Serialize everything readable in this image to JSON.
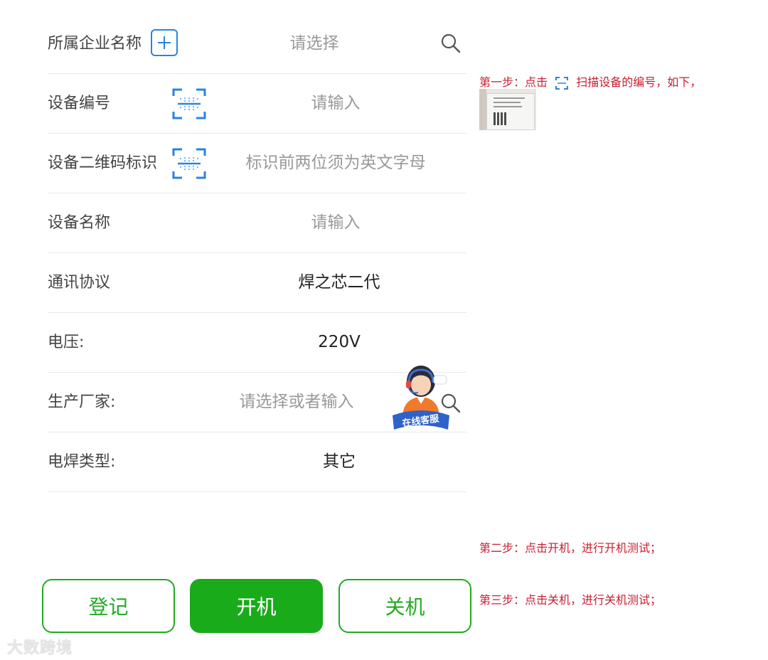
{
  "form": {
    "company": {
      "label": "所属企业名称",
      "placeholder": "请选择"
    },
    "device_no": {
      "label": "设备编号",
      "placeholder": "请输入"
    },
    "qr_id": {
      "label": "设备二维码标识",
      "placeholder": "标识前两位须为英文字母"
    },
    "device_name": {
      "label": "设备名称",
      "placeholder": "请输入"
    },
    "protocol": {
      "label": "通讯协议",
      "value": "焊之芯二代"
    },
    "voltage": {
      "label": "电压:",
      "value": "220V"
    },
    "manufacturer": {
      "label": "生产厂家:",
      "placeholder": "请选择或者输入"
    },
    "weld_type": {
      "label": "电焊类型:",
      "value": "其它"
    }
  },
  "buttons": {
    "register": "登记",
    "power_on": "开机",
    "power_off": "关机"
  },
  "notes": {
    "step1_prefix": "第一步：点击",
    "step1_suffix": "扫描设备的编号，如下，",
    "step2": "第二步：点击开机，进行开机测试；",
    "step3": "第三步：点击关机，进行关机测试；"
  },
  "service_badge": "在线客服",
  "watermark": "大数跨境",
  "colors": {
    "accent_green": "#1aab1a",
    "accent_blue": "#2a83e0",
    "note_red": "#c81e2e"
  }
}
